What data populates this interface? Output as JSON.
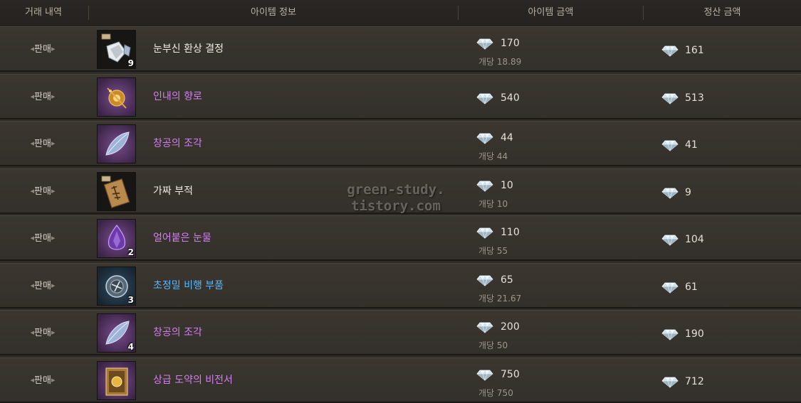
{
  "colors": {
    "normal": "#f0ece2",
    "epic": "#d27ff0",
    "rare": "#55b8ff"
  },
  "header": {
    "trade_history": "거래 내역",
    "item_info": "아이템 정보",
    "item_price": "아이템 금액",
    "settle_amount": "정산 금액"
  },
  "watermark": {
    "line1": "green-study.",
    "line2": "tistory.com"
  },
  "rows": [
    {
      "type": "판매",
      "icon": "crystal-shard-icon",
      "count": "9",
      "name": "눈부신 환상 결정",
      "grade": "normal",
      "price": "170",
      "unit_label": "개당",
      "unit_price": "18.89",
      "settle": "161"
    },
    {
      "type": "판매",
      "icon": "censer-icon",
      "count": "",
      "name": "인내의 향로",
      "grade": "epic",
      "price": "540",
      "unit_label": "",
      "unit_price": "",
      "settle": "513"
    },
    {
      "type": "판매",
      "icon": "feather-fragment-icon",
      "count": "",
      "name": "창공의 조각",
      "grade": "epic",
      "price": "44",
      "unit_label": "개당",
      "unit_price": "44",
      "settle": "41"
    },
    {
      "type": "판매",
      "icon": "talisman-icon",
      "count": "",
      "name": "가짜 부적",
      "grade": "normal",
      "price": "10",
      "unit_label": "개당",
      "unit_price": "10",
      "settle": "9"
    },
    {
      "type": "판매",
      "icon": "purple-tear-icon",
      "count": "2",
      "name": "얼어붙은 눈물",
      "grade": "epic",
      "price": "110",
      "unit_label": "개당",
      "unit_price": "55",
      "settle": "104"
    },
    {
      "type": "판매",
      "icon": "flight-part-icon",
      "count": "3",
      "name": "초정밀 비행 부품",
      "grade": "rare",
      "price": "65",
      "unit_label": "개당",
      "unit_price": "21.67",
      "settle": "61"
    },
    {
      "type": "판매",
      "icon": "feather-fragment-icon",
      "count": "4",
      "name": "창공의 조각",
      "grade": "epic",
      "price": "200",
      "unit_label": "개당",
      "unit_price": "50",
      "settle": "190"
    },
    {
      "type": "판매",
      "icon": "scroll-book-icon",
      "count": "",
      "name": "상급 도약의 비전서",
      "grade": "epic",
      "price": "750",
      "unit_label": "개당",
      "unit_price": "750",
      "settle": "712"
    }
  ]
}
